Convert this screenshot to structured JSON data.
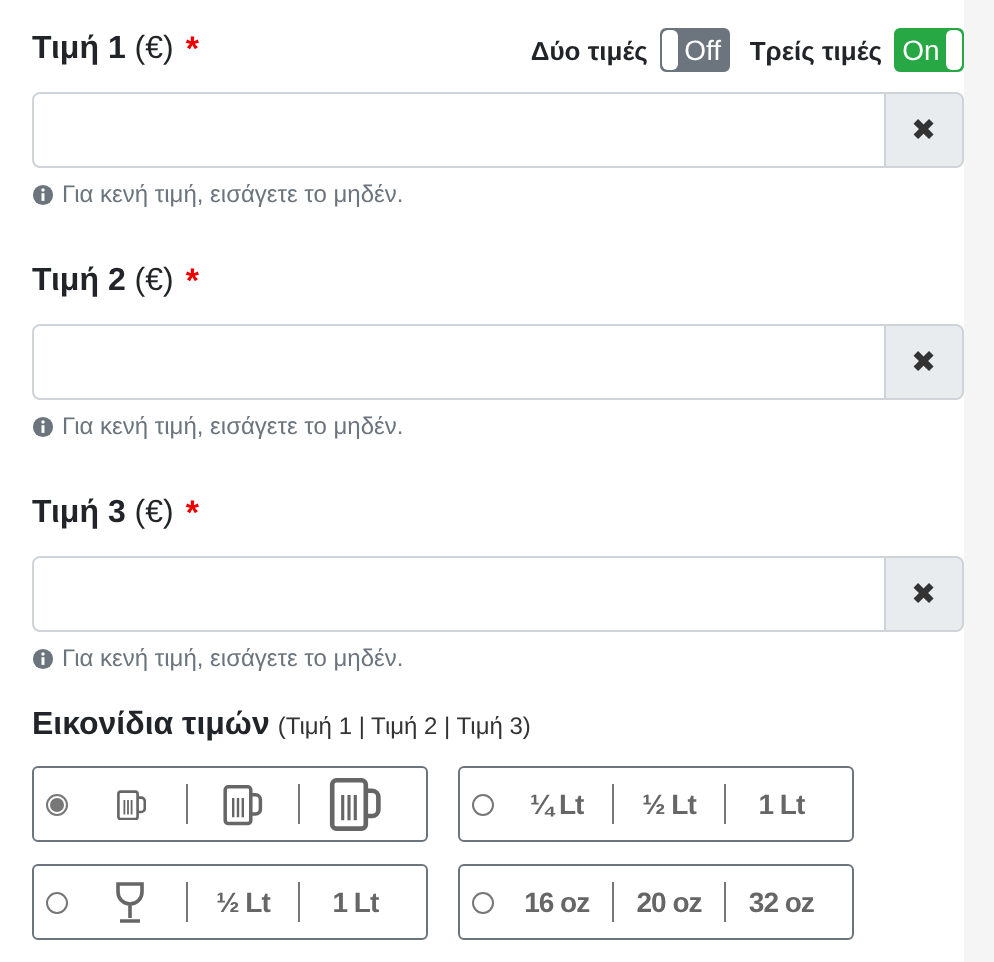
{
  "toggles": [
    {
      "label": "Δύο τιμές",
      "on": false,
      "text": "Off"
    },
    {
      "label": "Τρείς τιμές",
      "on": true,
      "text": "On"
    }
  ],
  "prices": [
    {
      "label": "Τιμή 1",
      "unit": "(€)",
      "required_mark": "*",
      "clear": "✖",
      "help": "Για κενή τιμή, εισάγετε το μηδέν."
    },
    {
      "label": "Τιμή 2",
      "unit": "(€)",
      "required_mark": "*",
      "clear": "✖",
      "help": "Για κενή τιμή, εισάγετε το μηδέν."
    },
    {
      "label": "Τιμή 3",
      "unit": "(€)",
      "required_mark": "*",
      "clear": "✖",
      "help": "Για κενή τιμή, εισάγετε το μηδέν."
    }
  ],
  "icons_section": {
    "title": "Εικονίδια τιμών",
    "subtitle": "(Τιμή 1 | Τιμή 2 | Τιμή 3)",
    "options": [
      {
        "selected": true,
        "segments": [
          {
            "kind": "mug"
          },
          {
            "kind": "mug"
          },
          {
            "kind": "mug"
          }
        ]
      },
      {
        "selected": false,
        "segments": [
          {
            "kind": "text",
            "text": "¼ Lt"
          },
          {
            "kind": "text",
            "text": "½ Lt"
          },
          {
            "kind": "text",
            "text": "1 Lt"
          }
        ]
      },
      {
        "selected": false,
        "segments": [
          {
            "kind": "glass"
          },
          {
            "kind": "text",
            "text": "½ Lt"
          },
          {
            "kind": "text",
            "text": "1 Lt"
          }
        ]
      },
      {
        "selected": false,
        "segments": [
          {
            "kind": "text",
            "text": "16 oz"
          },
          {
            "kind": "text",
            "text": "20 oz"
          },
          {
            "kind": "text",
            "text": "32 oz"
          }
        ]
      }
    ]
  }
}
